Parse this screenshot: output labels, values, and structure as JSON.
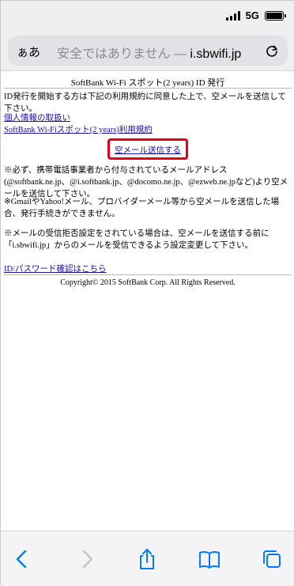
{
  "status_bar": {
    "network": "5G"
  },
  "address_bar": {
    "text_size_label": "ぁあ",
    "insecure_label": "安全ではありません — ",
    "host": "i.sbwifi.jp"
  },
  "page": {
    "title": "SoftBank Wi-Fi スポット(2 years) ID 発行",
    "intro": "ID発行を開始する方は下記の利用規約に同意した上で、空メールを送信して下さい。",
    "links": {
      "privacy": "個人情報の取扱い",
      "terms": "SoftBank Wi-Fiスポット(2 years)利用規約"
    },
    "send_button": "空メール送信する",
    "notes": [
      "※必ず、携帯電話事業者から付与されているメールアドレス(@softbank.ne.jp、@i.softbank.jp、@docomo.ne.jp、@ezweb.ne.jpなど)より空メールを送信して下さい。",
      "※GmailやYahoo!メール、プロバイダーメール等から空メールを送信した場合、発行手続きができません。",
      "※メールの受信拒否設定をされている場合は、空メールを送信する前に「i.sbwifi.jp」からのメールを受信できるよう設定変更して下さい。"
    ],
    "password_link": "ID/パスワード確認はこちら",
    "copyright": "Copyright© 2015 SoftBank Corp. All Rights Reserved."
  },
  "toolbar": {
    "icons": [
      "back-icon",
      "forward-icon",
      "share-icon",
      "bookmarks-icon",
      "tabs-icon"
    ]
  },
  "colors": {
    "highlight": "#e60012",
    "link": "#1a0dab",
    "ios_blue": "#007aff"
  }
}
